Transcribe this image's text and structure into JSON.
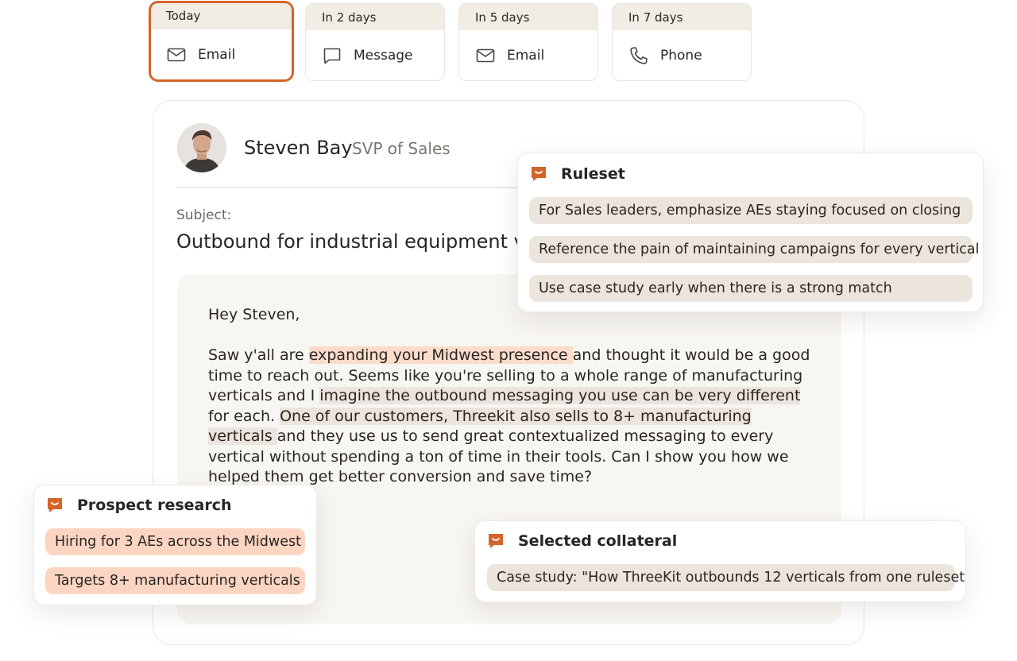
{
  "steps": [
    {
      "label": "Today",
      "channel": "Email",
      "icon": "mail-icon",
      "active": true
    },
    {
      "label": "In 2 days",
      "channel": "Message",
      "icon": "message-icon",
      "active": false
    },
    {
      "label": "In 5 days",
      "channel": "Email",
      "icon": "mail-icon",
      "active": false
    },
    {
      "label": "In 7 days",
      "channel": "Phone",
      "icon": "phone-icon",
      "active": false
    }
  ],
  "prospect": {
    "name": "Steven Bay",
    "title": "SVP of Sales"
  },
  "email": {
    "subject_label": "Subject:",
    "subject": "Outbound for industrial equipment v",
    "greeting": "Hey Steven,",
    "segments": [
      {
        "text": "Saw y'all are ",
        "hl": ""
      },
      {
        "text": "expanding your Midwest presence ",
        "hl": "orange"
      },
      {
        "text": "and thought it would be a good time to reach out. Seems like you're selling to a whole range of manufacturing verticals and I ",
        "hl": ""
      },
      {
        "text": "imagine the outbound messaging you use can be very different ",
        "hl": "tan"
      },
      {
        "text": "for each. ",
        "hl": ""
      },
      {
        "text": "One of our customers, Threekit also sells to 8+ manufacturing verticals ",
        "hl": "tan"
      },
      {
        "text": "and they use us to send great contextualized messaging to every vertical without spending a ton of time in their tools. Can I show you how we helped them get better conversion and save time?",
        "hl": ""
      }
    ]
  },
  "ruleset": {
    "title": "Ruleset",
    "rules": [
      "For Sales leaders, emphasize AEs staying focused on closing",
      "Reference the pain of maintaining campaigns for every vertical",
      "Use case study early when there is a strong match"
    ]
  },
  "prospect_research": {
    "title": "Prospect research",
    "items": [
      "Hiring for 3 AEs across the Midwest",
      "Targets 8+ manufacturing verticals"
    ]
  },
  "collateral": {
    "title": "Selected collateral",
    "items": [
      "Case study: \"How ThreeKit outbounds 12 verticals from one ruleset"
    ]
  },
  "colors": {
    "accent": "#d4652a",
    "highlight_orange": "#fbdccb",
    "highlight_tan": "#ece5dd",
    "chip_peach": "#fbd5c2"
  }
}
